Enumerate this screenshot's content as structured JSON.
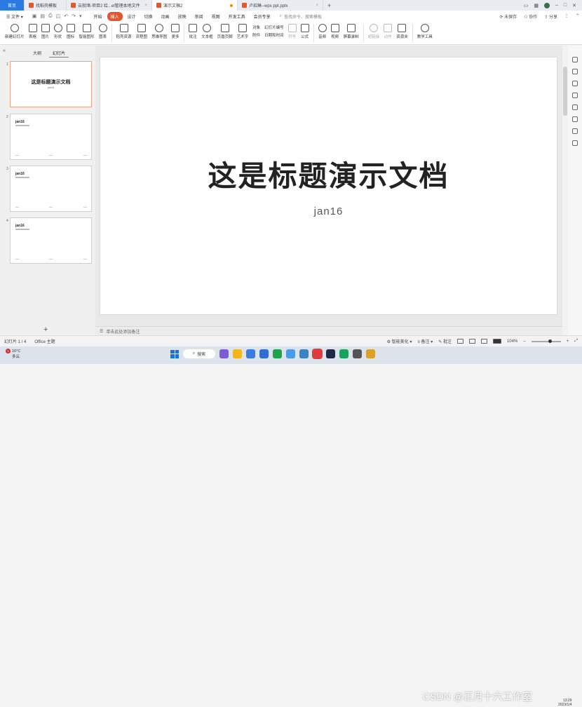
{
  "titlebar": {
    "tabs": [
      {
        "label": "首页",
        "type": "home"
      },
      {
        "label": "找稻壳模板",
        "type": "doc"
      },
      {
        "label": "云就绪-项目2 绘...el管理本地文件",
        "type": "doc"
      },
      {
        "label": "演示文稿2",
        "type": "active"
      },
      {
        "label": "卢招琳--wps ppt.pptx",
        "type": "doc"
      }
    ],
    "new_tab": "+"
  },
  "menubar": {
    "file_label": "文件",
    "items": [
      "开始",
      "插入",
      "设计",
      "切换",
      "动画",
      "放映",
      "审阅",
      "视图",
      "开发工具",
      "会员专享"
    ],
    "active_item": "插入",
    "search_placeholder": "查找命令、搜索模板",
    "unsaved": "未保存",
    "collab": "协作",
    "share": "分享"
  },
  "ribbon": {
    "buttons": [
      {
        "label": "新建幻灯片",
        "name": "new-slide-button"
      },
      {
        "label": "表格",
        "name": "table-button"
      },
      {
        "label": "图片",
        "name": "picture-button"
      },
      {
        "label": "形状",
        "name": "shape-button"
      },
      {
        "label": "图标",
        "name": "icon-button"
      },
      {
        "label": "智能图形",
        "name": "smartart-button"
      },
      {
        "label": "图表",
        "name": "chart-button"
      },
      {
        "label": "稻壳资源",
        "name": "docer-resource-button"
      },
      {
        "label": "流程图",
        "name": "flowchart-button"
      },
      {
        "label": "思维导图",
        "name": "mindmap-button"
      },
      {
        "label": "更多",
        "name": "more-button"
      },
      {
        "label": "批注",
        "name": "comment-button"
      },
      {
        "label": "文本框",
        "name": "textbox-button"
      },
      {
        "label": "页眉页脚",
        "name": "header-footer-button"
      },
      {
        "label": "艺术字",
        "name": "wordart-button"
      }
    ],
    "stack_top": [
      "对象",
      "幻灯片编号"
    ],
    "stack_bottom": [
      "附件",
      "日期和时间"
    ],
    "buttons2": [
      {
        "label": "符号",
        "name": "symbol-button",
        "dim": true
      },
      {
        "label": "公式",
        "name": "formula-button",
        "dim": false
      },
      {
        "label": "音频",
        "name": "audio-button",
        "dim": false
      },
      {
        "label": "视频",
        "name": "video-button",
        "dim": false
      },
      {
        "label": "屏幕录制",
        "name": "screen-record-button",
        "dim": false
      },
      {
        "label": "超链接",
        "name": "hyperlink-button",
        "dim": true
      },
      {
        "label": "动作",
        "name": "action-button",
        "dim": true
      },
      {
        "label": "资源夹",
        "name": "resource-folder-button",
        "dim": false
      },
      {
        "label": "教学工具",
        "name": "teaching-tools-button",
        "dim": false
      }
    ]
  },
  "left_pane": {
    "tabs": [
      "大纲",
      "幻灯片"
    ],
    "active_tab": "幻灯片",
    "slides": [
      {
        "num": "1",
        "title": "这是标题演示文档",
        "subtitle": "jan16",
        "selected": true
      },
      {
        "num": "2",
        "title": "jan16",
        "line": true
      },
      {
        "num": "3",
        "title": "jan16",
        "line": true
      },
      {
        "num": "4",
        "title": "jan16",
        "line": true
      }
    ],
    "add_slide": "+"
  },
  "slide": {
    "title": "这是标题演示文档",
    "subtitle": "jan16"
  },
  "notes": {
    "placeholder": "单击此处添加备注"
  },
  "status": {
    "slide_count": "幻灯片 1 / 4",
    "theme": "Office 主题",
    "smart_beautify": "智能美化",
    "notes": "备注",
    "comments": "批注",
    "zoom": "104%",
    "zoom_level_percent": 104
  },
  "taskbar": {
    "weather_temp": "16°C",
    "weather_desc": "多云",
    "badge": "1",
    "search": "搜索",
    "time": "13:29",
    "date": "2023/1/4",
    "watermark": "CSDN @正月十六工作室",
    "app_colors": [
      "#7b5cd6",
      "#f2b51b",
      "#3c7be0",
      "#2f6fd1",
      "#1fa34a",
      "#4a9be8",
      "#3b82c4",
      "#e03c3c",
      "#1f2a44",
      "#1aa15d",
      "#555555",
      "#d9a02b"
    ]
  },
  "colors": {
    "accent": "#e4572e",
    "home_tab": "#2b79e4"
  }
}
